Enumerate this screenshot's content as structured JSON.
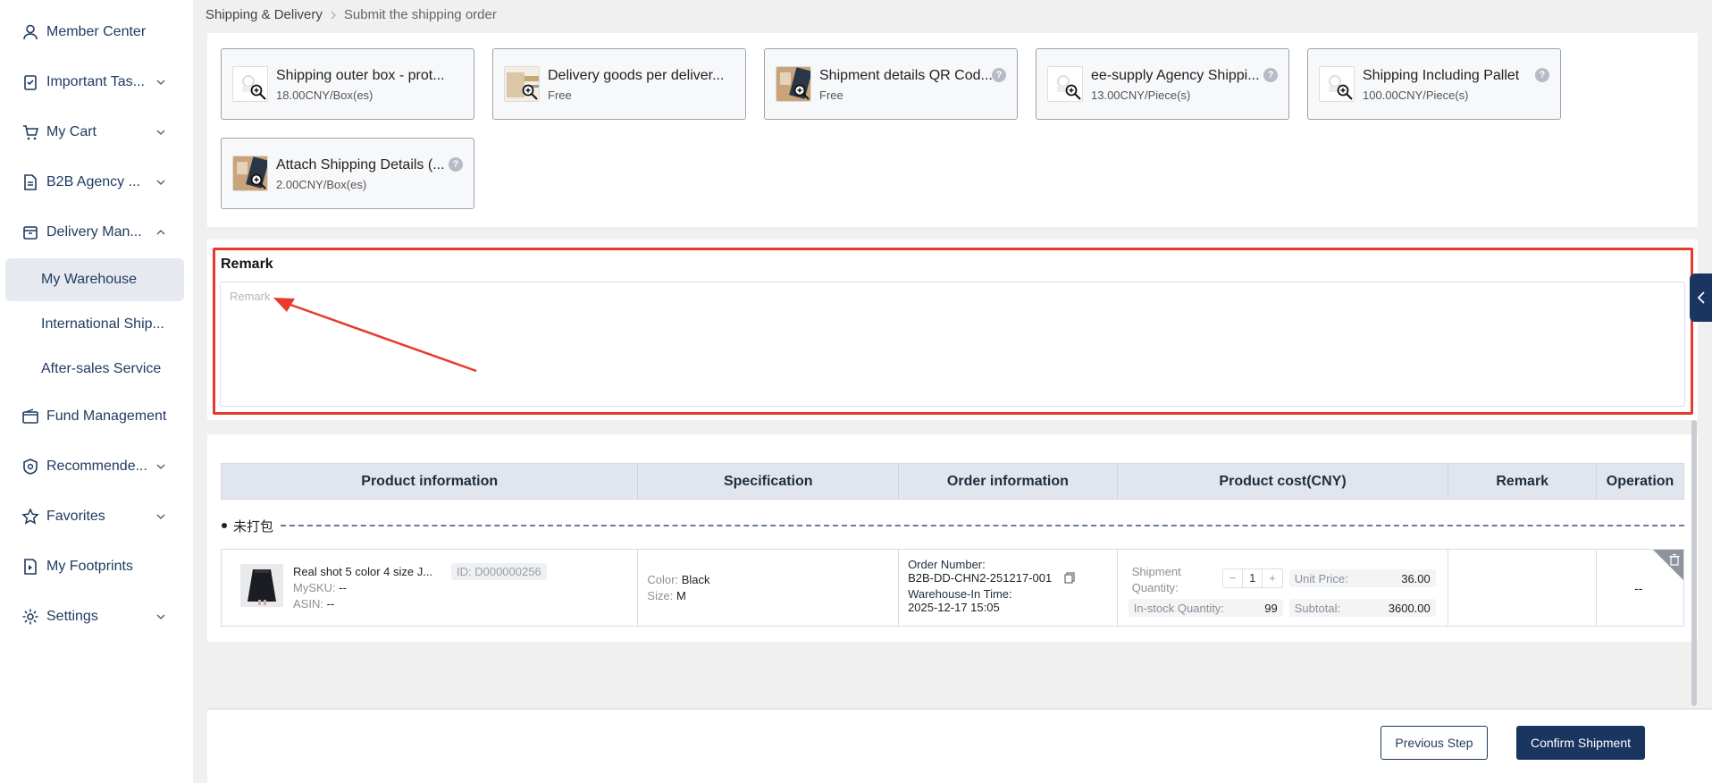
{
  "sidebar": {
    "items": [
      {
        "label": "Member Center",
        "icon": "user-icon",
        "chevron": ""
      },
      {
        "label": "Important Tas...",
        "icon": "clipboard-icon",
        "chevron": "down"
      },
      {
        "label": "My Cart",
        "icon": "cart-icon",
        "chevron": "down"
      },
      {
        "label": "B2B Agency ...",
        "icon": "document-icon",
        "chevron": "down"
      },
      {
        "label": "Delivery Man...",
        "icon": "box-icon",
        "chevron": "up"
      },
      {
        "label": "Fund Management",
        "icon": "wallet-icon",
        "chevron": ""
      },
      {
        "label": "Recommende...",
        "icon": "badge-icon",
        "chevron": "down"
      },
      {
        "label": "Favorites",
        "icon": "star-icon",
        "chevron": "down"
      },
      {
        "label": "My Footprints",
        "icon": "footprint-icon",
        "chevron": ""
      },
      {
        "label": "Settings",
        "icon": "gear-icon",
        "chevron": "down"
      }
    ],
    "subitems": [
      {
        "label": "My Warehouse",
        "active": true
      },
      {
        "label": "International Ship...",
        "active": false
      },
      {
        "label": "After-sales Service",
        "active": false
      }
    ]
  },
  "breadcrumb": {
    "parent": "Shipping & Delivery",
    "current": "Submit the shipping order"
  },
  "services": [
    {
      "name": "Shipping outer box - prot...",
      "price": "18.00CNY/Box(es)",
      "help": false
    },
    {
      "name": "Delivery goods per deliver...",
      "price": "Free",
      "help": false
    },
    {
      "name": "Shipment details QR Cod...",
      "price": "Free",
      "help": true
    },
    {
      "name": "ee-supply Agency Shippi...",
      "price": "13.00CNY/Piece(s)",
      "help": true
    },
    {
      "name": "Shipping Including Pallet",
      "price": "100.00CNY/Piece(s)",
      "help": true
    },
    {
      "name": "Attach Shipping Details (...",
      "price": "2.00CNY/Box(es)",
      "help": true
    }
  ],
  "help_glyph": "?",
  "remark": {
    "title": "Remark",
    "placeholder": "Remark",
    "value": ""
  },
  "table": {
    "headers": [
      "Product information",
      "Specification",
      "Order information",
      "Product cost(CNY)",
      "Remark",
      "Operation"
    ],
    "group_label": "未打包",
    "rows": [
      {
        "title": "Real shot 5 color 4 size J...",
        "id": "ID: D000000256",
        "mysku_label": "MySKU:",
        "mysku": "--",
        "asin_label": "ASIN:",
        "asin": "--",
        "color_label": "Color:",
        "color": "Black",
        "size_label": "Size:",
        "size": "M",
        "order_number_label": "Order Number:",
        "order_number": "B2B-DD-CHN2-251217-001",
        "warehouse_in_label": "Warehouse-In Time:",
        "warehouse_in_time": "2025-12-17 15:05",
        "shipment_qty_label": "Shipment Quantity:",
        "shipment_qty": "1",
        "minus": "−",
        "plus": "+",
        "instock_label": "In-stock Quantity:",
        "instock_qty": "99",
        "unit_price_label": "Unit Price:",
        "unit_price": "36.00",
        "subtotal_label": "Subtotal:",
        "subtotal": "3600.00",
        "remark": "",
        "operation": "--"
      }
    ]
  },
  "footer": {
    "previous_label": "Previous Step",
    "confirm_label": "Confirm Shipment"
  },
  "colors": {
    "accent": "#1a3560",
    "highlight": "#e8392e"
  }
}
